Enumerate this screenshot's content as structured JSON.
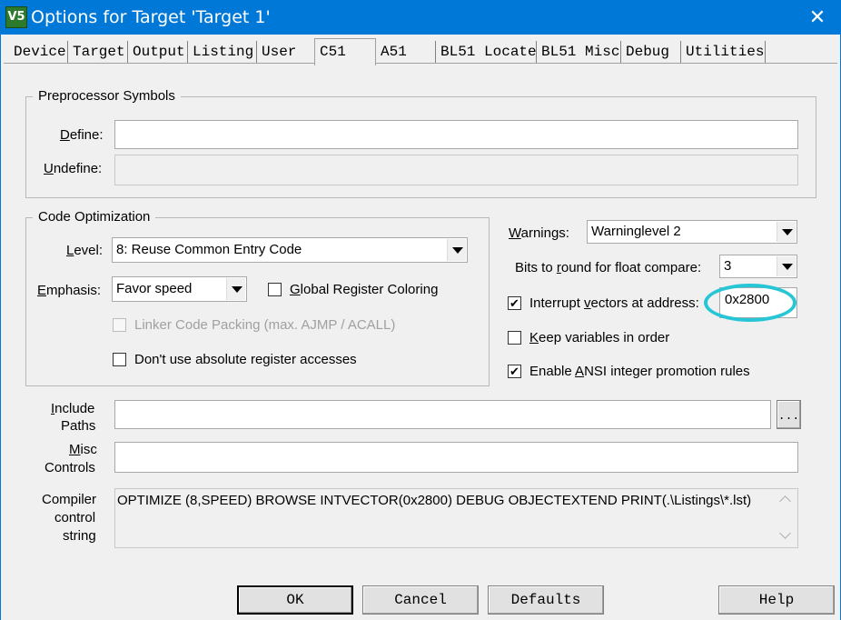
{
  "window": {
    "title": "Options for Target 'Target 1'",
    "close_glyph": "✕",
    "app_icon_text": "V5"
  },
  "tabs": [
    "Device",
    "Target",
    "Output",
    "Listing",
    "User",
    "C51",
    "A51",
    "BL51 Locate",
    "BL51 Misc",
    "Debug",
    "Utilities"
  ],
  "active_tab": "C51",
  "preprocessor": {
    "title": "Preprocessor Symbols",
    "define": {
      "label_u": "D",
      "label_rest": "efine:",
      "value": ""
    },
    "undefine": {
      "label_u": "U",
      "label_rest": "ndefine:",
      "value": ""
    }
  },
  "optimization": {
    "title": "Code Optimization",
    "level": {
      "label_u": "L",
      "label_rest": "evel:",
      "value": "8: Reuse Common Entry Code"
    },
    "emphasis": {
      "label_u": "E",
      "label_rest": "mphasis:",
      "value": "Favor speed"
    },
    "global_register": {
      "label_u": "G",
      "label_rest": "lobal Register Coloring",
      "checked": false
    },
    "linker_packing": {
      "label": "Linker Code Packing (max. AJMP / ACALL)",
      "checked": false,
      "enabled": false
    },
    "no_absolute": {
      "label": "Don't use absolute register accesses",
      "checked": false
    }
  },
  "right": {
    "warnings": {
      "label_u": "W",
      "label_rest": "arnings:",
      "value": "Warninglevel 2"
    },
    "bits_round": {
      "label_pre": "Bits to ",
      "label_u": "r",
      "label_rest": "ound for float compare:",
      "value": "3"
    },
    "interrupt": {
      "label_pre": "Interrupt ",
      "label_u": "v",
      "label_rest": "ectors at address:",
      "value": "0x2800",
      "checked": true
    },
    "keep_vars": {
      "label_u": "K",
      "label_rest": "eep variables in order",
      "checked": false
    },
    "ansi": {
      "label_pre": "Enable ",
      "label_u": "A",
      "label_rest": "NSI integer promotion rules",
      "checked": true
    }
  },
  "include_paths": {
    "label_line1_u": "I",
    "label_line1_rest": "nclude",
    "label_line2": "Paths",
    "value": "",
    "browse": "..."
  },
  "misc_controls": {
    "label_line1_u": "M",
    "label_line1_rest": "isc",
    "label_line2": "Controls",
    "value": ""
  },
  "compiler_string": {
    "label_line1": "Compiler",
    "label_line2": "control",
    "label_line3": "string",
    "value": "OPTIMIZE (8,SPEED) BROWSE INTVECTOR(0x2800) DEBUG OBJECTEXTEND PRINT(.\\Listings\\*.lst)"
  },
  "buttons": {
    "ok": "OK",
    "cancel": "Cancel",
    "defaults": "Defaults",
    "help": "Help"
  },
  "colors": {
    "titlebar": "#0078d7",
    "highlight_circle": "#26c6d6"
  },
  "check_glyph": "✔"
}
